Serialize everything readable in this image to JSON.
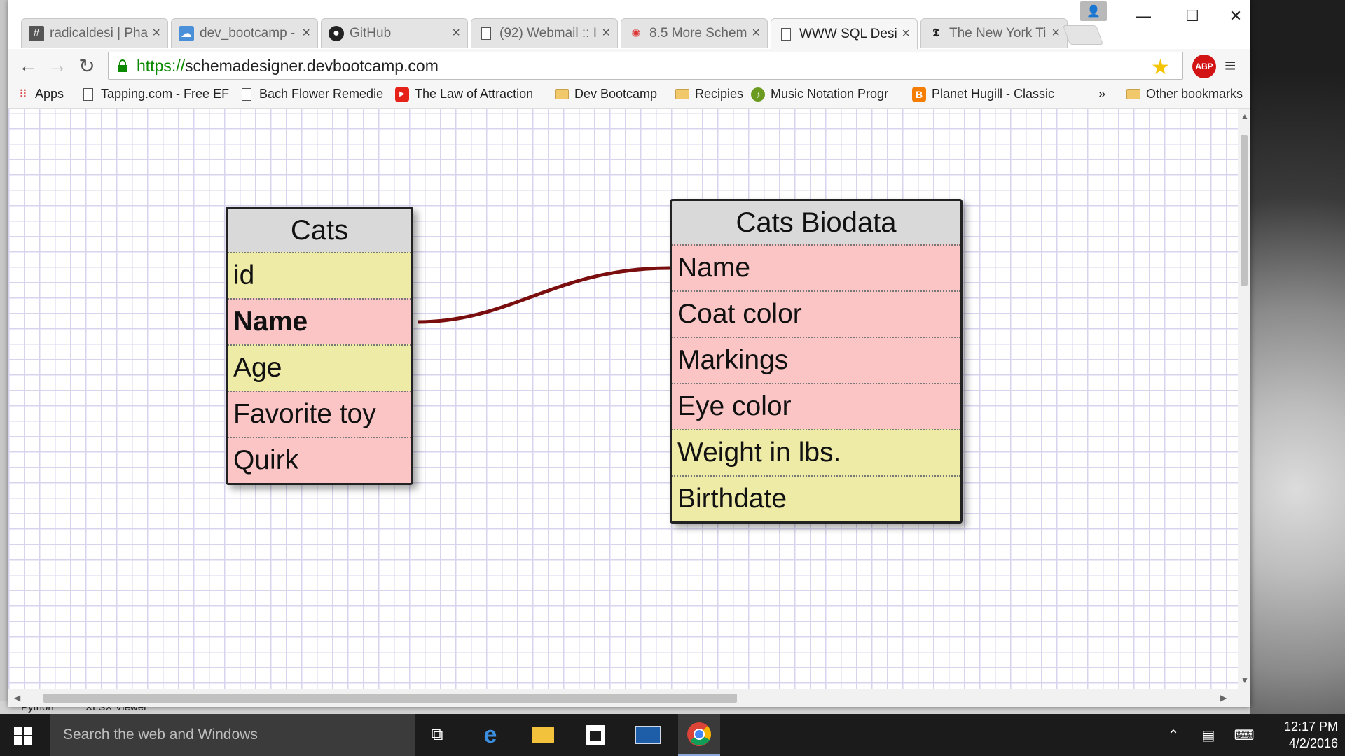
{
  "browser": {
    "tabs": [
      {
        "title": "radicaldesi | Pha",
        "icon": "hash-icon",
        "active": false
      },
      {
        "title": "dev_bootcamp -",
        "icon": "cloud-icon",
        "active": false
      },
      {
        "title": "GitHub",
        "icon": "github-icon",
        "active": false
      },
      {
        "title": "(92) Webmail :: I",
        "icon": "page-icon",
        "active": false
      },
      {
        "title": "8.5 More Schem",
        "icon": "gear-icon",
        "active": false
      },
      {
        "title": "WWW SQL Desig",
        "icon": "page-icon",
        "active": true
      },
      {
        "title": "The New York Ti",
        "icon": "nyt-icon",
        "active": false
      }
    ],
    "address": {
      "scheme": "https://",
      "host": "schemadesigner.devbootcamp.com"
    },
    "bookmarks": [
      {
        "label": "Apps",
        "icon": "apps-grid-icon"
      },
      {
        "label": "Tapping.com - Free EF",
        "icon": "page-icon"
      },
      {
        "label": "Bach Flower Remedie",
        "icon": "page-icon"
      },
      {
        "label": "The Law of Attraction",
        "icon": "youtube-icon"
      },
      {
        "label": "Dev Bootcamp",
        "icon": "folder-icon"
      },
      {
        "label": "Recipies",
        "icon": "folder-icon"
      },
      {
        "label": "Music Notation Progr",
        "icon": "music-icon"
      },
      {
        "label": "Planet Hugill - Classic",
        "icon": "blogger-icon"
      }
    ],
    "overflow": "»",
    "other_bookmarks": "Other bookmarks",
    "abp_label": "ABP"
  },
  "schema": {
    "tables": [
      {
        "title": "Cats",
        "rows": [
          {
            "label": "id",
            "color": "#eeeba6",
            "bold": false
          },
          {
            "label": "Name",
            "color": "#fbc5c5",
            "bold": true
          },
          {
            "label": "Age",
            "color": "#eeeba6",
            "bold": false
          },
          {
            "label": "Favorite toy",
            "color": "#fbc5c5",
            "bold": false
          },
          {
            "label": "Quirk",
            "color": "#fbc5c5",
            "bold": false
          }
        ]
      },
      {
        "title": "Cats Biodata",
        "rows": [
          {
            "label": "Name",
            "color": "#fbc5c5",
            "bold": false
          },
          {
            "label": "Coat color",
            "color": "#fbc5c5",
            "bold": false
          },
          {
            "label": "Markings",
            "color": "#fbc5c5",
            "bold": false
          },
          {
            "label": "Eye color",
            "color": "#fbc5c5",
            "bold": false
          },
          {
            "label": "Weight in lbs.",
            "color": "#eeeba6",
            "bold": false
          },
          {
            "label": "Birthdate",
            "color": "#eeeba6",
            "bold": false
          }
        ]
      }
    ],
    "relation_color": "#7a0e0e"
  },
  "desktop": {
    "apps_labels": [
      "Python",
      "XLSX Viewer"
    ]
  },
  "taskbar": {
    "search_placeholder": "Search the web and Windows",
    "time": "12:17 PM",
    "date": "4/2/2016"
  }
}
